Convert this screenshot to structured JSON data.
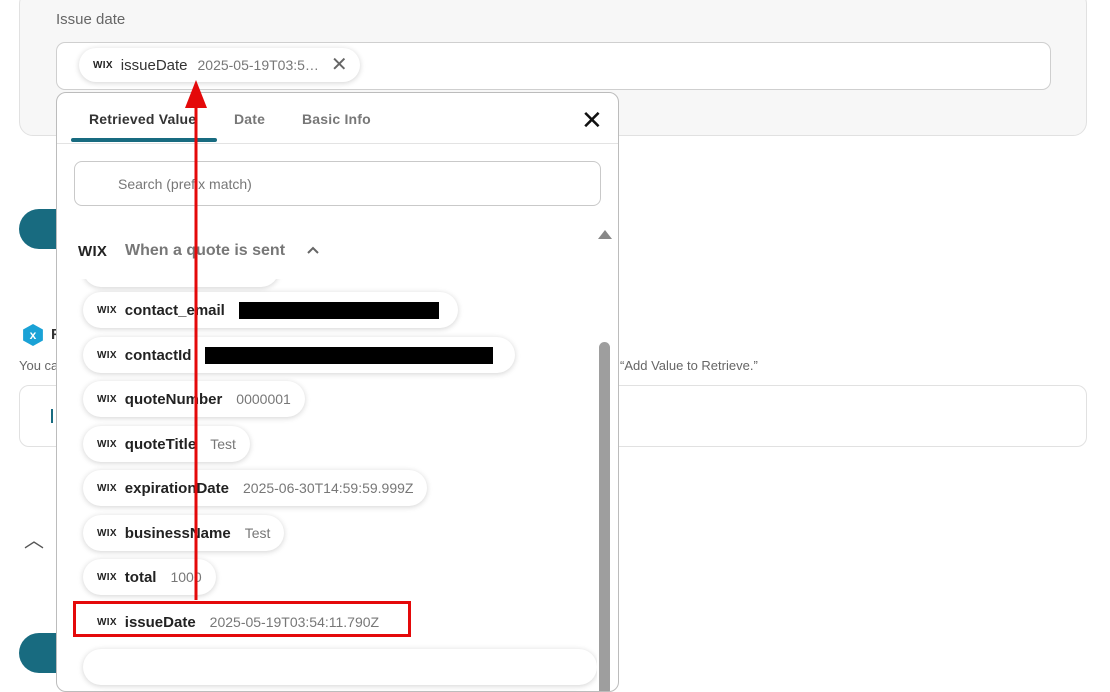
{
  "field": {
    "label": "Issue date",
    "chip": {
      "wix": "WIX",
      "name": "issueDate",
      "value": "2025-05-19T03:5…"
    }
  },
  "background": {
    "letter": "F",
    "you_text": "You ca",
    "add_text": "“Add Value to Retrieve.”"
  },
  "popup": {
    "tabs": [
      "Retrieved Value",
      "Date",
      "Basic Info"
    ],
    "search_placeholder": "Search (prefix match)",
    "group": {
      "wix": "WIX",
      "title": "When a quote is sent"
    },
    "items": [
      {
        "wix": "WIX",
        "name": "contact_email",
        "value": ""
      },
      {
        "wix": "WIX",
        "name": "contactId",
        "value": ""
      },
      {
        "wix": "WIX",
        "name": "quoteNumber",
        "value": "0000001"
      },
      {
        "wix": "WIX",
        "name": "quoteTitle",
        "value": "Test"
      },
      {
        "wix": "WIX",
        "name": "expirationDate",
        "value": "2025-06-30T14:59:59.999Z"
      },
      {
        "wix": "WIX",
        "name": "businessName",
        "value": "Test"
      },
      {
        "wix": "WIX",
        "name": "total",
        "value": "1000"
      },
      {
        "wix": "WIX",
        "name": "issueDate",
        "value": "2025-05-19T03:54:11.790Z"
      }
    ]
  },
  "colors": {
    "accent": "#186b80",
    "highlight": "#e4090a"
  }
}
